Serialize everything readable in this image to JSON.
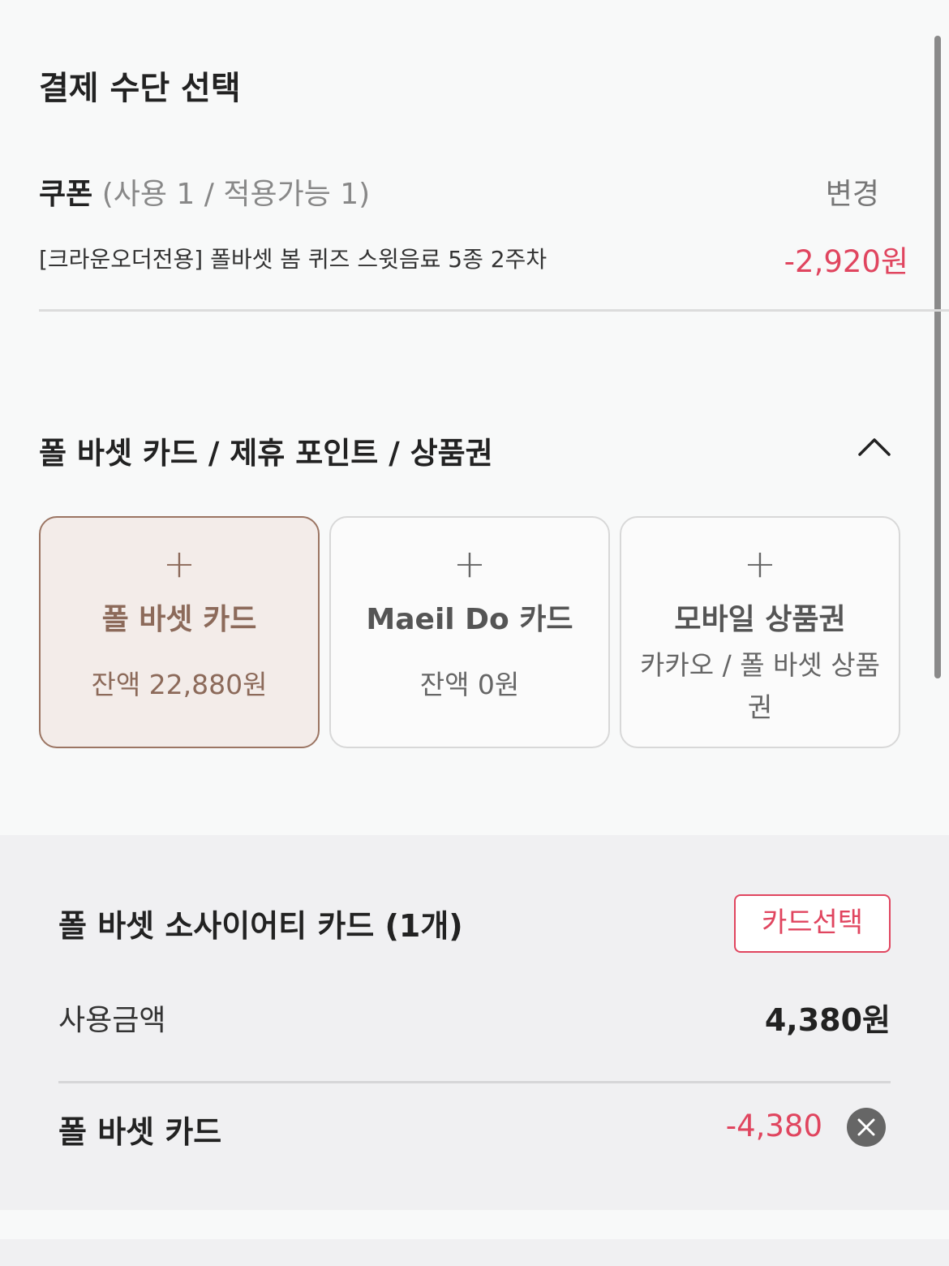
{
  "payment": {
    "title": "결제 수단 선택"
  },
  "coupon": {
    "label": "쿠폰",
    "count_text": " (사용 1 / 적용가능 1)",
    "change_label": "변경",
    "name": "[크라운오더전용] 폴바셋 봄 퀴즈 스윗음료 5종 2주차",
    "discount": "-2,920원"
  },
  "methods": {
    "header": "폴 바셋 카드 / 제휴 포인트 / 상품권",
    "options": [
      {
        "name": "폴 바셋 카드",
        "sub": "잔액 22,880원",
        "selected": true
      },
      {
        "name": "Maeil Do 카드",
        "sub": "잔액 0원",
        "selected": false
      },
      {
        "name": "모바일 상품권",
        "sub": "카카오 / 폴 바셋 상품권",
        "selected": false
      }
    ]
  },
  "society_card": {
    "title": "폴 바셋 소사이어티 카드 (1개)",
    "select_label": "카드선택",
    "use_label": "사용금액",
    "use_amount": "4,380원",
    "applied_label": "폴 바셋 카드",
    "applied_amount": "-4,380"
  },
  "colors": {
    "accent_red": "#e0455f",
    "brand_brown": "#9b7563"
  }
}
